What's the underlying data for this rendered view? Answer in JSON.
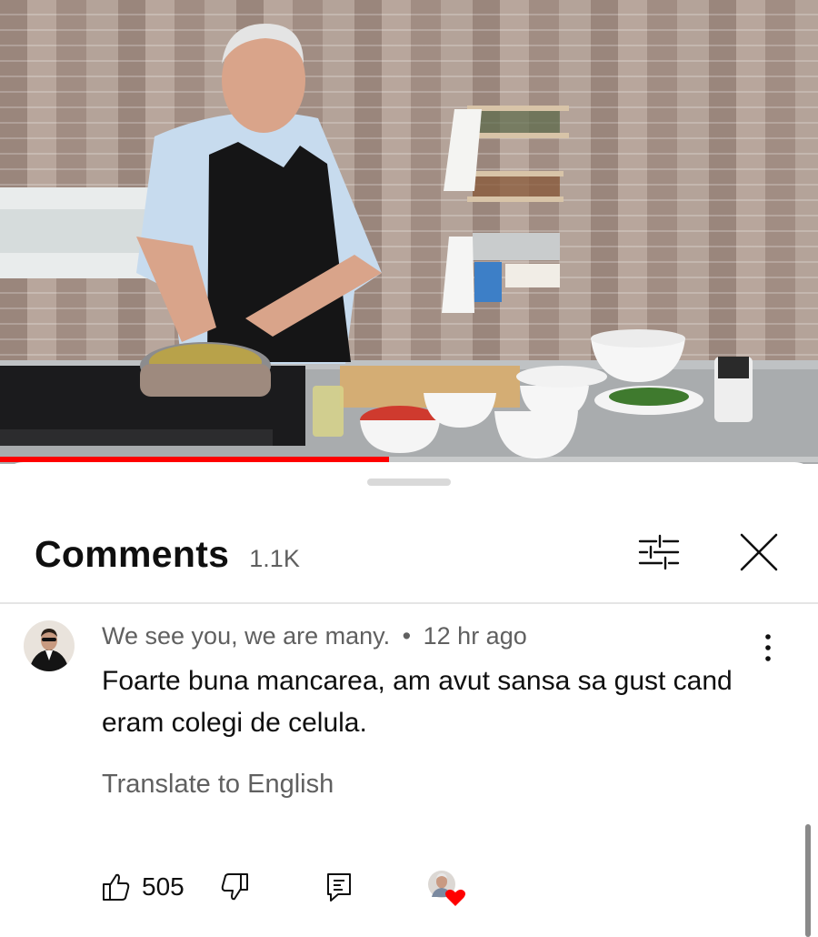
{
  "video": {
    "progress_fraction": 0.475
  },
  "comments_panel": {
    "title": "Comments",
    "count": "1.1K",
    "filter_icon": "sort-filter-icon",
    "close_icon": "close-icon"
  },
  "comment": {
    "author": "We see you, we are many.",
    "separator": "•",
    "time": "12 hr ago",
    "text": "Foarte buna mancarea, am avut sansa sa gust cand eram colegi de celula.",
    "translate_label": "Translate to English",
    "like_count": "505",
    "icons": {
      "like": "thumbs-up-icon",
      "dislike": "thumbs-down-icon",
      "reply": "reply-icon",
      "more": "more-vertical-icon",
      "creator_heart": "creator-heart-icon"
    }
  },
  "colors": {
    "progress": "#ff0000",
    "heart": "#ff0000",
    "secondary_text": "#606060"
  }
}
